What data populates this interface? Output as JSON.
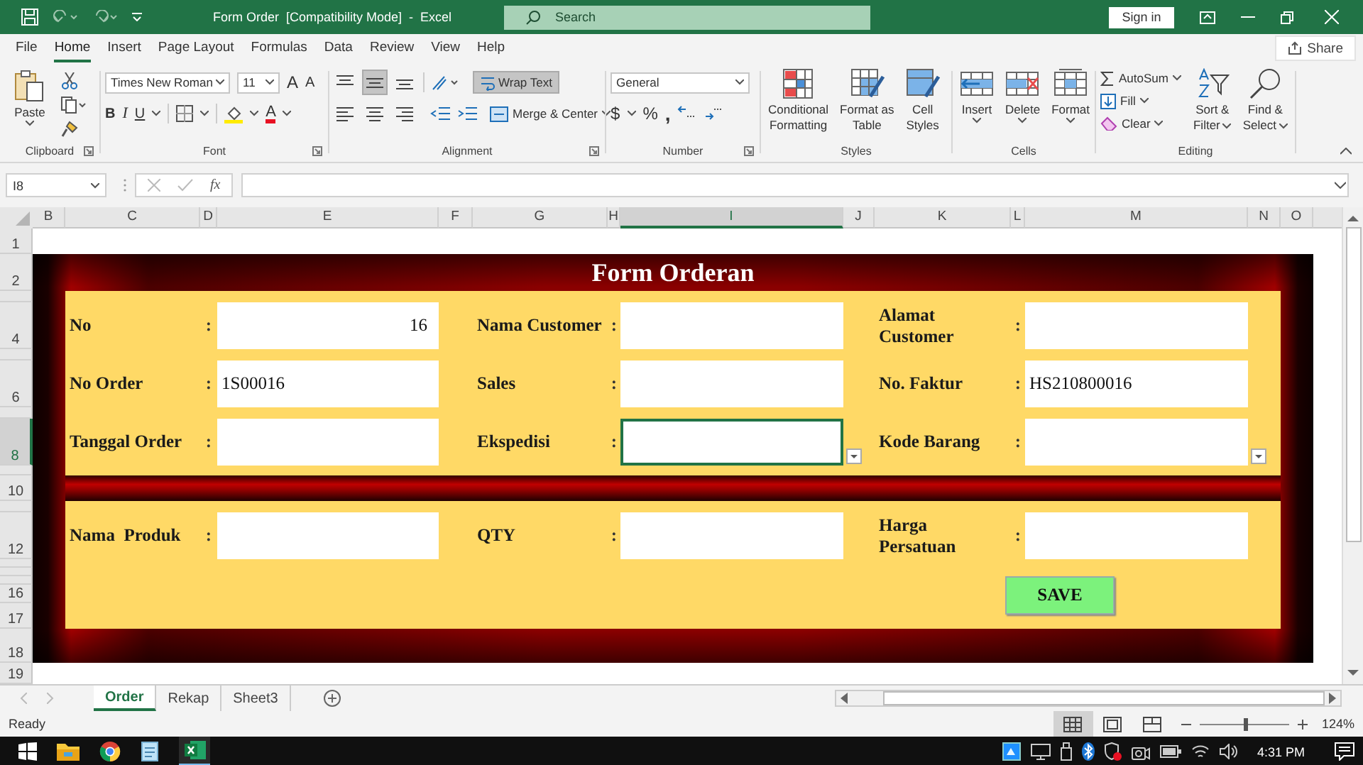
{
  "window": {
    "title": "Form Order  [Compatibility Mode]  -  Excel",
    "search": {
      "placeholder": "Search"
    },
    "sign_in": "Sign in"
  },
  "menu_tabs": [
    {
      "label": "File",
      "selected": false
    },
    {
      "label": "Home",
      "selected": true
    },
    {
      "label": "Insert",
      "selected": false
    },
    {
      "label": "Page Layout",
      "selected": false
    },
    {
      "label": "Formulas",
      "selected": false
    },
    {
      "label": "Data",
      "selected": false
    },
    {
      "label": "Review",
      "selected": false
    },
    {
      "label": "View",
      "selected": false
    },
    {
      "label": "Help",
      "selected": false
    }
  ],
  "share": "Share",
  "ribbon": {
    "clipboard": {
      "paste": "Paste",
      "label": "Clipboard"
    },
    "font": {
      "family": "Times New Roman",
      "size": "11",
      "grow": "A",
      "shrink": "A",
      "bold": "B",
      "italic": "I",
      "underline": "U",
      "font_color": "A",
      "label": "Font"
    },
    "alignment": {
      "vertical": [
        {
          "kind": "top",
          "selected": false
        },
        {
          "kind": "middle",
          "selected": true
        },
        {
          "kind": "bottom",
          "selected": false
        }
      ],
      "wrap_text": {
        "label": "Wrap Text",
        "selected": true
      },
      "merge": "Merge & Center",
      "label": "Alignment"
    },
    "number": {
      "format": "General",
      "currency": "$",
      "percent": "%",
      "comma": ",",
      "label": "Number"
    },
    "styles": {
      "items": [
        {
          "kind": "conditional",
          "lines": [
            "Conditional",
            "Formatting"
          ]
        },
        {
          "kind": "table",
          "lines": [
            "Format as",
            "Table"
          ]
        },
        {
          "kind": "cell_styles",
          "lines": [
            "Cell",
            "Styles"
          ]
        }
      ],
      "label": "Styles"
    },
    "cells": {
      "items": [
        {
          "kind": "insert",
          "lines": [
            "Insert"
          ]
        },
        {
          "kind": "delete",
          "lines": [
            "Delete"
          ]
        },
        {
          "kind": "format",
          "lines": [
            "Format"
          ]
        }
      ],
      "label": "Cells"
    },
    "editing": {
      "autosum": "AutoSum",
      "fill": "Fill",
      "clear": "Clear",
      "sort": [
        "Sort &",
        "Filter"
      ],
      "find": [
        "Find &",
        "Select"
      ],
      "label": "Editing"
    }
  },
  "formula_bar": {
    "name_box": "I8",
    "function": "fx"
  },
  "columns": [
    {
      "label": "B",
      "selected": false
    },
    {
      "label": "C",
      "selected": false
    },
    {
      "label": "D",
      "selected": false
    },
    {
      "label": "E",
      "selected": false
    },
    {
      "label": "F",
      "selected": false
    },
    {
      "label": "G",
      "selected": false
    },
    {
      "label": "H",
      "selected": false
    },
    {
      "label": "I",
      "selected": true
    },
    {
      "label": "J",
      "selected": false
    },
    {
      "label": "K",
      "selected": false
    },
    {
      "label": "L",
      "selected": false
    },
    {
      "label": "M",
      "selected": false
    },
    {
      "label": "N",
      "selected": false
    },
    {
      "label": "O",
      "selected": false
    }
  ],
  "rows": [
    {
      "label": "1",
      "selected": false
    },
    {
      "label": "2",
      "selected": false
    },
    {
      "selected": false
    },
    {
      "label": "4",
      "selected": false
    },
    {
      "selected": false
    },
    {
      "label": "6",
      "selected": false
    },
    {
      "selected": false
    },
    {
      "label": "8",
      "selected": true
    },
    {
      "selected": false
    },
    {
      "label": "10",
      "selected": false
    },
    {
      "selected": false
    },
    {
      "label": "12",
      "selected": false
    },
    {
      "selected": false
    },
    {
      "selected": false
    },
    {
      "selected": false
    },
    {
      "label": "16",
      "selected": false
    },
    {
      "label": "17",
      "selected": false
    },
    {
      "label": "18",
      "selected": false
    },
    {
      "label": "19",
      "selected": false
    }
  ],
  "form": {
    "title": "Form Orderan",
    "sections": [
      {
        "rows": [
          [
            {
              "label": "No",
              "separator": ":",
              "value": "16",
              "right_aligned": true,
              "selected": false
            },
            {
              "label": "Nama Customer",
              "separator": ":",
              "selected": false
            },
            {
              "label": "Alamat Customer",
              "separator": ":",
              "wrap": true,
              "selected": false
            }
          ],
          [
            {
              "label": "No Order",
              "separator": ":",
              "value": "1S00016",
              "selected": false
            },
            {
              "label": "Sales",
              "separator": ":",
              "selected": false
            },
            {
              "label": "No. Faktur",
              "separator": ":",
              "value": "HS210800016",
              "selected": false
            }
          ],
          [
            {
              "label": "Tanggal Order",
              "separator": ":",
              "selected": false
            },
            {
              "label": "Ekspedisi",
              "separator": ":",
              "selected": true,
              "dropdown": true
            },
            {
              "label": "Kode Barang",
              "separator": ":",
              "selected": false,
              "dropdown": true
            }
          ]
        ]
      },
      {
        "rows": [
          [
            {
              "label": "Nama  Produk",
              "separator": ":",
              "selected": false
            },
            {
              "label": "QTY",
              "separator": ":",
              "selected": false
            },
            {
              "label": "Harga Persatuan",
              "separator": ":",
              "wrap": true,
              "selected": false
            }
          ]
        ]
      }
    ],
    "save": "SAVE"
  },
  "sheet_tabs": [
    {
      "label": "Order",
      "selected": true
    },
    {
      "label": "Rekap",
      "selected": false
    },
    {
      "label": "Sheet3",
      "selected": false
    }
  ],
  "status": {
    "text": "Ready",
    "views": [
      {
        "kind": "normal",
        "selected": true
      },
      {
        "kind": "page_layout",
        "selected": false
      },
      {
        "kind": "page_break",
        "selected": false
      }
    ],
    "zoom": {
      "level": 0.52,
      "reading": "124%"
    }
  },
  "taskbar": {
    "time": "4:31 PM"
  }
}
